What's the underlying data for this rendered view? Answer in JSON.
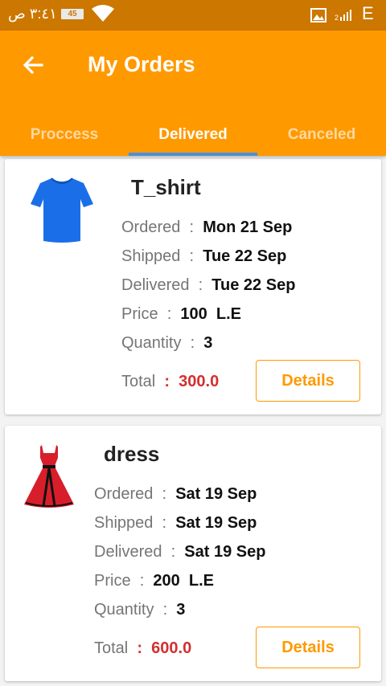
{
  "status_bar": {
    "time": "٣:٤١ ص",
    "battery": "45",
    "network": "E"
  },
  "app_bar": {
    "title": "My Orders"
  },
  "tabs": [
    {
      "label": "Proccess",
      "active": false
    },
    {
      "label": "Delivered",
      "active": true
    },
    {
      "label": "Canceled",
      "active": false
    }
  ],
  "labels": {
    "ordered": "Ordered",
    "shipped": "Shipped",
    "delivered": "Delivered",
    "price": "Price",
    "quantity": "Quantity",
    "total": "Total",
    "sep": ":",
    "details_button": "Details"
  },
  "orders": [
    {
      "name": "T_shirt",
      "ordered": "Mon 21 Sep",
      "shipped": "Tue 22 Sep",
      "delivered": "Tue 22 Sep",
      "price": "100  L.E",
      "quantity": "3",
      "total": "300.0",
      "image": "blue-tshirt"
    },
    {
      "name": "dress",
      "ordered": "Sat 19 Sep",
      "shipped": "Sat 19 Sep",
      "delivered": "Sat 19 Sep",
      "price": "200  L.E",
      "quantity": "3",
      "total": "600.0",
      "image": "red-dress"
    }
  ],
  "colors": {
    "status_bar": "#cc7700",
    "primary": "#ff9900",
    "tab_indicator": "#4a90d9",
    "total": "#d32f2f"
  }
}
